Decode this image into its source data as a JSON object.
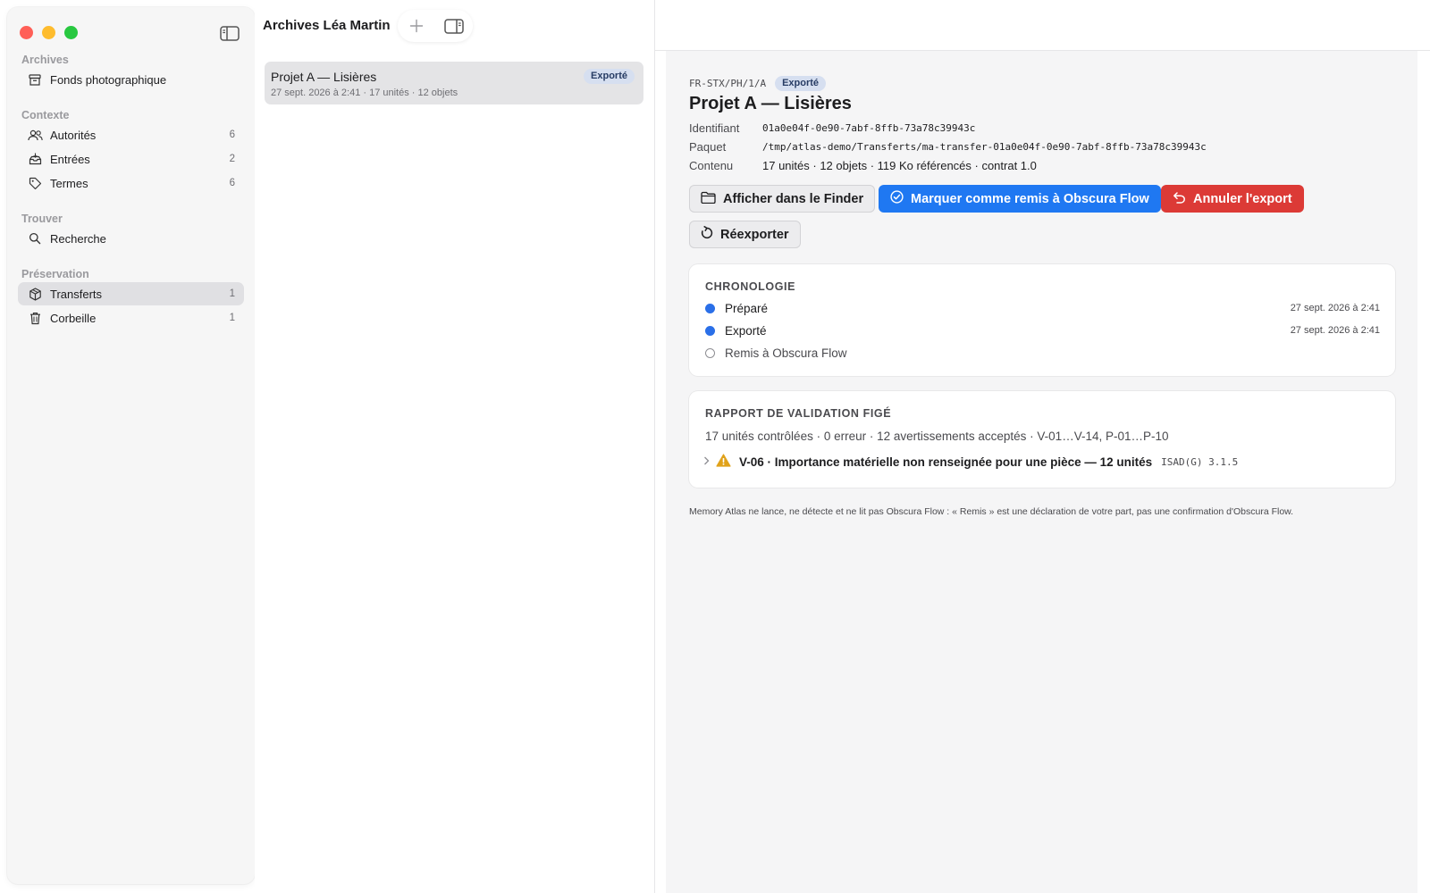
{
  "sidebar": {
    "sections": [
      {
        "title": "Archives",
        "items": [
          {
            "label": "Fonds photographique",
            "count": "",
            "icon": "archive-box-icon"
          }
        ]
      },
      {
        "title": "Contexte",
        "items": [
          {
            "label": "Autorités",
            "count": "6",
            "icon": "people-icon"
          },
          {
            "label": "Entrées",
            "count": "2",
            "icon": "tray-icon"
          },
          {
            "label": "Termes",
            "count": "6",
            "icon": "tag-icon"
          }
        ]
      },
      {
        "title": "Trouver",
        "items": [
          {
            "label": "Recherche",
            "count": "",
            "icon": "search-icon"
          }
        ]
      },
      {
        "title": "Préservation",
        "items": [
          {
            "label": "Transferts",
            "count": "1",
            "icon": "cube-icon",
            "selected": true
          },
          {
            "label": "Corbeille",
            "count": "1",
            "icon": "trash-icon"
          }
        ]
      }
    ]
  },
  "middle": {
    "title": "Archives Léa Martin",
    "list": [
      {
        "title": "Projet A — Lisières",
        "meta": "27 sept. 2026 à 2:41 · 17 unités · 12 objets",
        "badge": "Exporté"
      }
    ]
  },
  "detail": {
    "reference": "FR-STX/PH/1/A",
    "badge": "Exporté",
    "title": "Projet A — Lisières",
    "meta": {
      "identifiant_label": "Identifiant",
      "identifiant": "01a0e04f-0e90-7abf-8ffb-73a78c39943c",
      "paquet_label": "Paquet",
      "paquet": "/tmp/atlas-demo/Transferts/ma-transfer-01a0e04f-0e90-7abf-8ffb-73a78c39943c",
      "contenu_label": "Contenu",
      "contenu": "17 unités · 12 objets · 119 Ko référencés · contrat 1.0"
    },
    "actions": {
      "finder": "Afficher dans le Finder",
      "mark_delivered": "Marquer comme remis à Obscura Flow",
      "cancel": "Annuler l'export",
      "reexport": "Réexporter"
    },
    "chronologie": {
      "title": "CHRONOLOGIE",
      "steps": [
        {
          "label": "Préparé",
          "date": "27 sept. 2026 à 2:41",
          "done": true
        },
        {
          "label": "Exporté",
          "date": "27 sept. 2026 à 2:41",
          "done": true
        },
        {
          "label": "Remis à Obscura Flow",
          "date": "",
          "done": false
        }
      ]
    },
    "validation": {
      "title": "RAPPORT DE VALIDATION FIGÉ",
      "summary": "17 unités contrôlées · 0 erreur · 12 avertissements acceptés · V-01…V-14, P-01…P-10",
      "rule": "V-06 · Importance matérielle non renseignée pour une pièce — 12 unités",
      "standard": "ISAD(G) 3.1.5"
    },
    "footnote": "Memory Atlas ne lance, ne détecte et ne lit pas Obscura Flow : « Remis » est une déclaration de votre part, pas une confirmation d'Obscura Flow."
  },
  "colors": {
    "accent_blue": "#1f78f2",
    "danger_red": "#dc3a36",
    "badge_bg": "#d6dff0",
    "timeline_dot": "#2a6fe8",
    "warning": "#e0a21a"
  }
}
